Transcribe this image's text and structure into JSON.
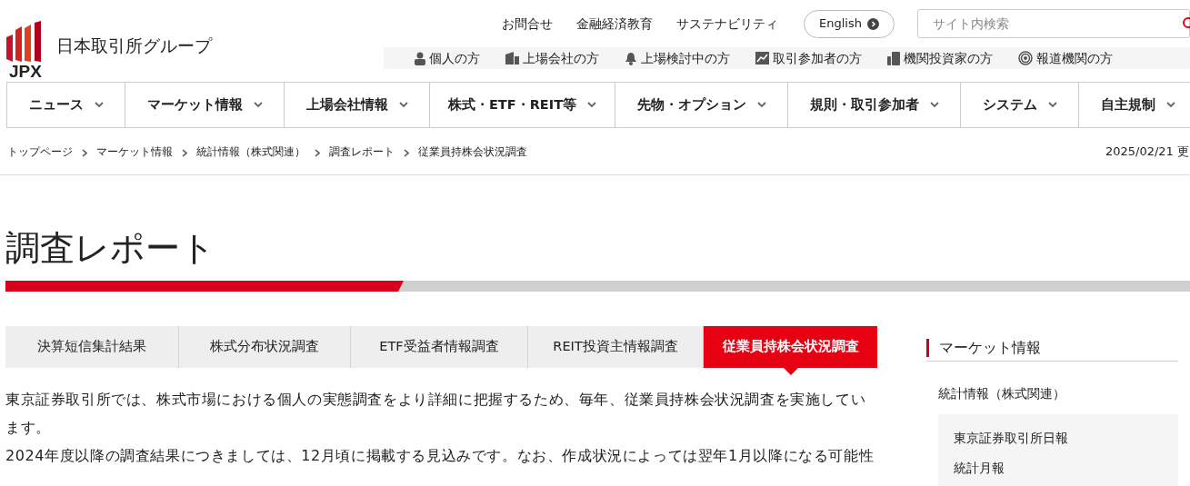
{
  "header": {
    "logo_text": "JPX",
    "group_name": "日本取引所グループ",
    "utility_links": [
      "お問合せ",
      "金融経済教育",
      "サステナビリティ"
    ],
    "language_button": "English",
    "search": {
      "placeholder": "サイト内検索"
    },
    "audience_links": [
      {
        "kind": "person",
        "label": "個人の方"
      },
      {
        "kind": "building",
        "label": "上場会社の方"
      },
      {
        "kind": "bell",
        "label": "上場検討中の方"
      },
      {
        "kind": "chart",
        "label": "取引参加者の方"
      },
      {
        "kind": "devices",
        "label": "機関投資家の方"
      },
      {
        "kind": "broadcast",
        "label": "報道機関の方"
      }
    ]
  },
  "main_nav": [
    "ニュース",
    "マーケット情報",
    "上場会社情報",
    "株式・ETF・REIT等",
    "先物・オプション",
    "規則・取引参加者",
    "システム",
    "自主規制"
  ],
  "breadcrumb": [
    "トップページ",
    "マーケット情報",
    "統計情報（株式関連）",
    "調査レポート",
    "従業員持株会状況調査"
  ],
  "updated": "2025/02/21 更",
  "page_title": "調査レポート",
  "tabs": [
    {
      "label": "決算短信集計結果",
      "selected": false
    },
    {
      "label": "株式分布状況調査",
      "selected": false
    },
    {
      "label": "ETF受益者情報調査",
      "selected": false
    },
    {
      "label": "REIT投資主情報調査",
      "selected": false
    },
    {
      "label": "従業員持株会状況調査",
      "selected": true
    }
  ],
  "paragraphs": [
    {
      "lines": [
        "東京証券取引所では、株式市場における個人の実態調査をより詳細に把握するため、毎年、従業員持株会状況調査を実施してい",
        "ます。"
      ]
    },
    {
      "lines": [
        "2024年度以降の調査結果につきましては、12月頃に掲載する見込みです。なお、作成状況によっては翌年1月以降になる可能性"
      ]
    }
  ],
  "sidebar": {
    "title": "マーケット情報",
    "section": "統計情報（株式関連）",
    "items": [
      "東京証券取引所日報",
      "統計月報"
    ]
  }
}
